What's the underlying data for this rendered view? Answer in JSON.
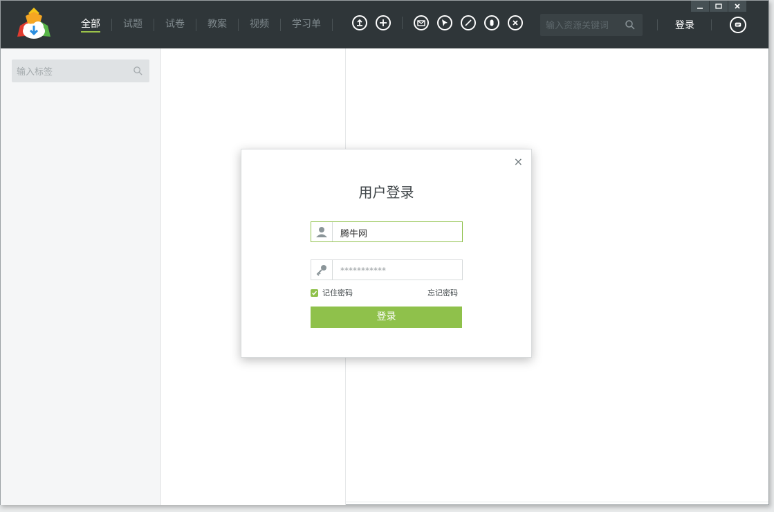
{
  "nav": {
    "items": [
      {
        "label": "全部",
        "active": true
      },
      {
        "label": "试题",
        "active": false
      },
      {
        "label": "试卷",
        "active": false
      },
      {
        "label": "教案",
        "active": false
      },
      {
        "label": "视频",
        "active": false
      },
      {
        "label": "学习单",
        "active": false
      }
    ]
  },
  "toolbar": {
    "icons": [
      "upload-icon",
      "add-icon",
      "email-icon",
      "cursor-icon",
      "pen-icon",
      "eraser-icon",
      "close-circle-icon"
    ]
  },
  "search": {
    "placeholder": "输入资源关键词"
  },
  "header": {
    "login_label": "登录"
  },
  "window_controls": {
    "minimize": "–",
    "maximize": "□",
    "close": "×"
  },
  "sidebar": {
    "tag_placeholder": "输入标签"
  },
  "dialog": {
    "close_label": "×",
    "title": "用户登录",
    "username_value": "腾牛网",
    "password_value": "***********",
    "remember_label": "记住密码",
    "remember_checked": true,
    "forgot_label": "忘记密码",
    "login_button": "登录"
  },
  "colors": {
    "accent": "#8fc14b",
    "topbar": "#2f3639"
  }
}
